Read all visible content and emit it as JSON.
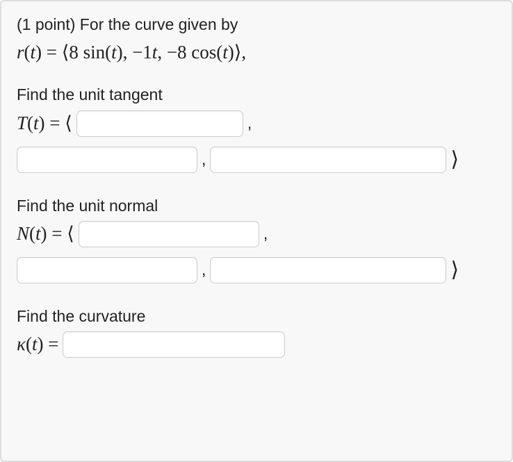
{
  "intro": {
    "points_prefix": "(1 point) For the curve given by",
    "curve_tex": "r(t) = ⟨8 sin(t), −1t, −8 cos(t)⟩,"
  },
  "tangent": {
    "prompt": "Find the unit tangent",
    "label": "T(t) = ⟨",
    "v1": "",
    "v2": "",
    "v3": "",
    "close": "⟩"
  },
  "normal": {
    "prompt": "Find the unit normal",
    "label": "N(t) = ⟨",
    "v1": "",
    "v2": "",
    "v3": "",
    "close": "⟩"
  },
  "curvature": {
    "prompt": "Find the curvature",
    "label": "κ(t) =",
    "v": ""
  },
  "sep": ","
}
